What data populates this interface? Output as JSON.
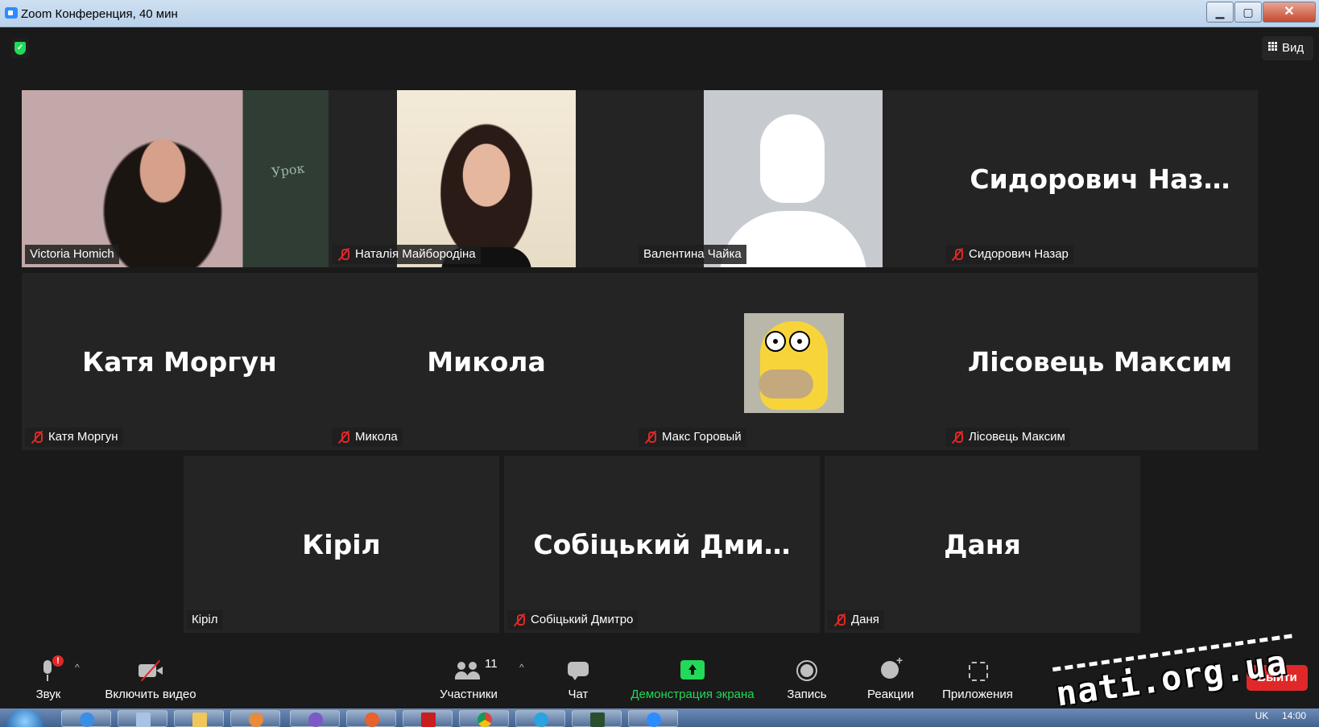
{
  "window": {
    "title": "Zoom Конференция, 40 мин",
    "min_glyph": "▁",
    "max_glyph": "▢",
    "close_glyph": "✕"
  },
  "topbar": {
    "view_label": "Вид",
    "security_icon": "shield-check-icon"
  },
  "participants": [
    {
      "name": "Victoria Homich",
      "display": "",
      "muted": false,
      "video": "camera"
    },
    {
      "name": "Наталія Майбородіна",
      "display": "",
      "muted": true,
      "video": "photo"
    },
    {
      "name": "Валентина Чайка",
      "display": "",
      "muted": false,
      "video": "default-avatar"
    },
    {
      "name": "Сидорович Назар",
      "display": "Сидорович  Наз…",
      "muted": true,
      "video": "off"
    },
    {
      "name": "Катя Моргун",
      "display": "Катя Моргун",
      "muted": true,
      "video": "off"
    },
    {
      "name": "Микола",
      "display": "Микола",
      "muted": true,
      "video": "off"
    },
    {
      "name": "Макс Горовый",
      "display": "",
      "muted": true,
      "video": "cartoon-avatar"
    },
    {
      "name": "Лісовець Максим",
      "display": "Лісовець Максим",
      "muted": true,
      "video": "off"
    },
    {
      "name": "Кіріл",
      "display": "Кіріл",
      "muted": false,
      "video": "off"
    },
    {
      "name": "Собіцький Дмитро",
      "display": "Собіцький Дми…",
      "muted": true,
      "video": "off"
    },
    {
      "name": "Даня",
      "display": "Даня",
      "muted": true,
      "video": "off"
    }
  ],
  "toolbar": {
    "audio_label": "Звук",
    "audio_badge": "!",
    "video_label": "Включить видео",
    "participants_label": "Участники",
    "participants_count": "11",
    "chat_label": "Чат",
    "share_label": "Демонстрация экрана",
    "record_label": "Запись",
    "reactions_label": "Реакции",
    "apps_label": "Приложения",
    "leave_label": "Выйти",
    "caret": "^"
  },
  "watermark": "nati.org.ua",
  "taskbar": {
    "lang": "UK",
    "clock": "14:00"
  },
  "colors": {
    "active_speaker_border": "#d7f76c",
    "share_green": "#23d959",
    "mute_red": "#e02828",
    "background": "#1a1a1a",
    "tile": "#242424"
  }
}
